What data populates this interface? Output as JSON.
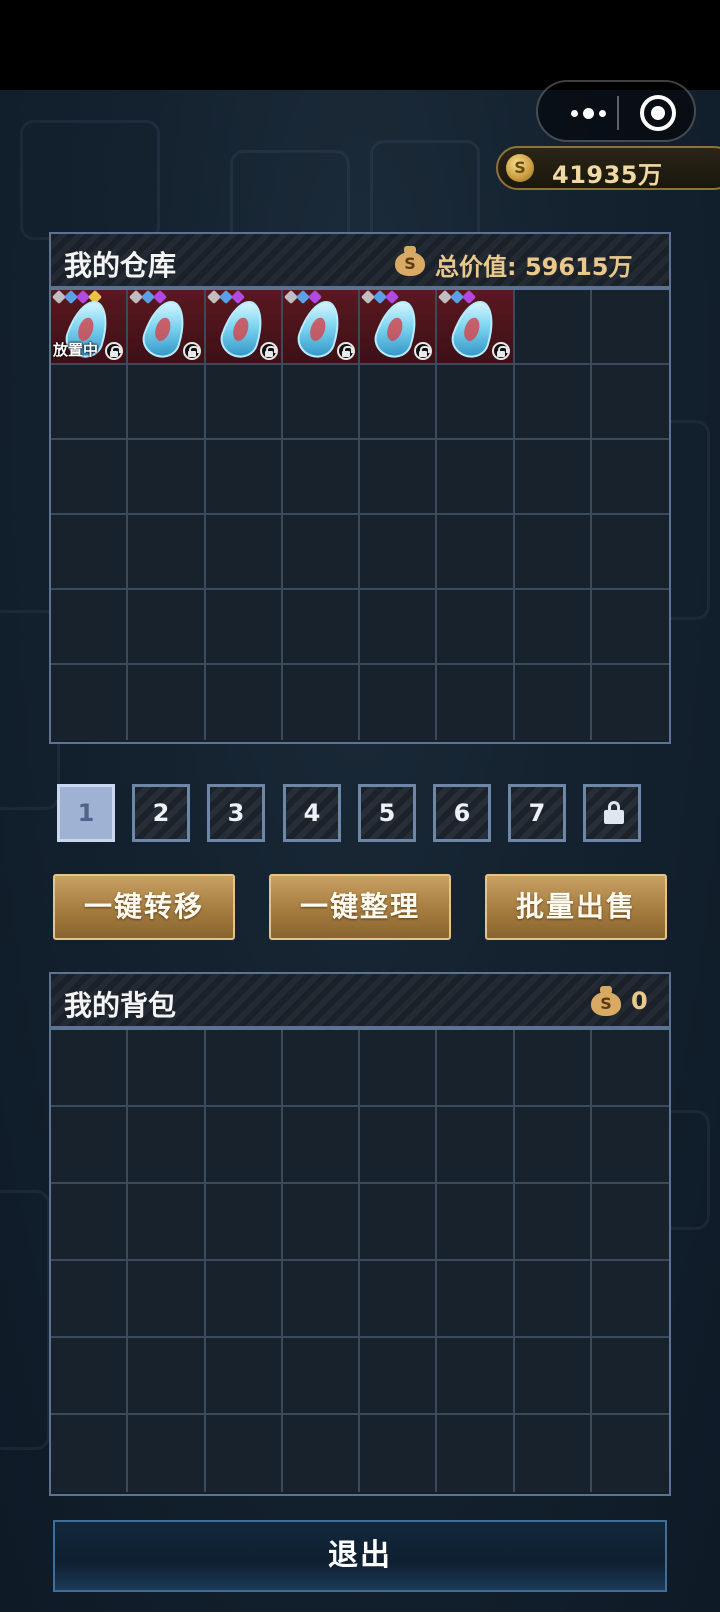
{
  "coins": {
    "value": "41935万"
  },
  "warehouse": {
    "title": "我的仓库",
    "value_label": "总价值:",
    "value": "59615万",
    "items": [
      {
        "slot": 1,
        "status": "放置中",
        "stars": [
          "#bfbfbf",
          "#5aa0e6",
          "#b04ae0",
          "#e8c24a"
        ],
        "locked": true
      },
      {
        "slot": 2,
        "status": "",
        "stars": [
          "#bfbfbf",
          "#5aa0e6",
          "#b04ae0"
        ],
        "locked": true
      },
      {
        "slot": 3,
        "status": "",
        "stars": [
          "#bfbfbf",
          "#5aa0e6",
          "#b04ae0"
        ],
        "locked": true
      },
      {
        "slot": 4,
        "status": "",
        "stars": [
          "#bfbfbf",
          "#5aa0e6",
          "#b04ae0"
        ],
        "locked": true
      },
      {
        "slot": 5,
        "status": "",
        "stars": [
          "#bfbfbf",
          "#5aa0e6",
          "#b04ae0"
        ],
        "locked": true
      },
      {
        "slot": 6,
        "status": "",
        "stars": [
          "#bfbfbf",
          "#5aa0e6",
          "#b04ae0"
        ],
        "locked": true
      }
    ]
  },
  "pages": [
    "1",
    "2",
    "3",
    "4",
    "5",
    "6",
    "7"
  ],
  "active_page": "1",
  "actions": {
    "transfer": "一键转移",
    "organize": "一键整理",
    "bulk_sell": "批量出售"
  },
  "backpack": {
    "title": "我的背包",
    "value": "0"
  },
  "exit_label": "退出",
  "colors": {
    "panel_border": "#5c7392",
    "gold_button": "#b08744",
    "item_bg": "#4d141b",
    "coin_text": "#f1d9a2"
  }
}
